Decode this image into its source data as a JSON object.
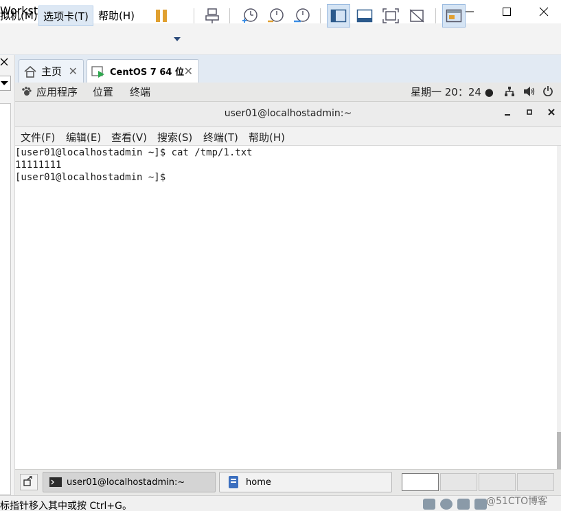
{
  "window": {
    "title": "Workstation"
  },
  "vm_menu": {
    "items": [
      {
        "label": "拟机(M)"
      },
      {
        "label": "选项卡(T)"
      },
      {
        "label": "帮助(H)"
      }
    ]
  },
  "tabs": [
    {
      "label": "主页",
      "icon": "home-icon"
    },
    {
      "label": "CentOS 7 64 位",
      "icon": "vm-running-icon"
    }
  ],
  "gnome_topbar": {
    "applications": "应用程序",
    "places": "位置",
    "terminal": "终端",
    "clock": "星期一 20：24 ●"
  },
  "terminal": {
    "title": "user01@localhostadmin:~",
    "menu": [
      "文件(F)",
      "编辑(E)",
      "查看(V)",
      "搜索(S)",
      "终端(T)",
      "帮助(H)"
    ],
    "lines": [
      "[user01@localhostadmin ~]$ cat /tmp/1.txt",
      "11111111",
      "[user01@localhostadmin ~]$"
    ]
  },
  "taskbar": {
    "items": [
      {
        "label": "user01@localhostadmin:~",
        "icon": "terminal-icon"
      },
      {
        "label": "home",
        "icon": "folder-icon"
      }
    ]
  },
  "statusbar": {
    "hint": "标指针移入其中或按 Ctrl+G。",
    "watermark": "@51CTO博客"
  },
  "colors": {
    "accent": "#3a8ee6",
    "pause": "#e0a030"
  }
}
